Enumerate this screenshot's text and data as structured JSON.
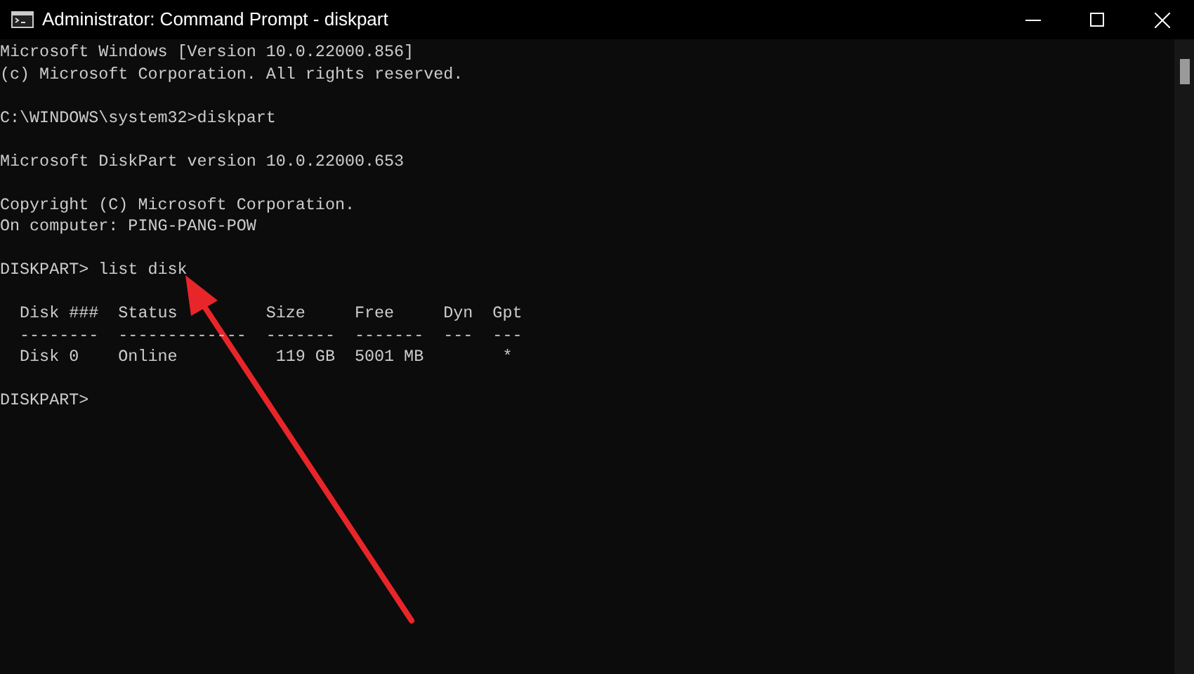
{
  "window": {
    "title": "Administrator: Command Prompt - diskpart"
  },
  "console": {
    "blocks": [
      {
        "lines": [
          "Microsoft Windows [Version 10.0.22000.856]",
          "(c) Microsoft Corporation. All rights reserved."
        ]
      },
      {
        "lines": [
          "C:\\WINDOWS\\system32>diskpart"
        ]
      },
      {
        "lines": [
          "Microsoft DiskPart version 10.0.22000.653"
        ]
      },
      {
        "lines": [
          "Copyright (C) Microsoft Corporation.",
          "On computer: PING-PANG-POW"
        ]
      },
      {
        "lines": [
          "DISKPART> list disk"
        ]
      },
      {
        "lines": [
          "  Disk ###  Status         Size     Free     Dyn  Gpt",
          "  --------  -------------  -------  -------  ---  ---",
          "  Disk 0    Online          119 GB  5001 MB        *"
        ]
      },
      {
        "lines": [
          "DISKPART>"
        ]
      }
    ]
  }
}
